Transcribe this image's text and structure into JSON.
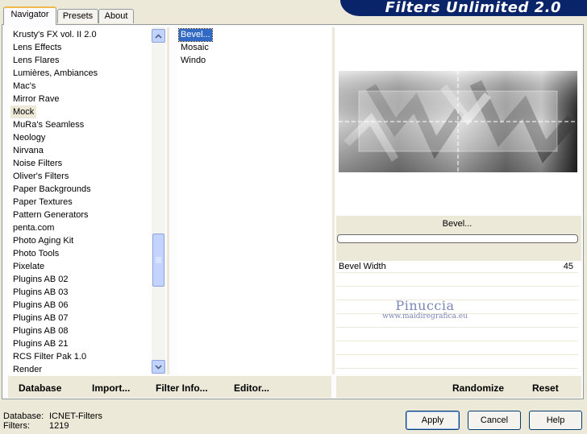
{
  "tabs": [
    {
      "label": "Navigator",
      "active": true
    },
    {
      "label": "Presets",
      "active": false
    },
    {
      "label": "About",
      "active": false
    }
  ],
  "app_title": "Filters Unlimited 2.0",
  "categories": [
    "Krusty's FX vol. II 2.0",
    "Lens Effects",
    "Lens Flares",
    "Lumières, Ambiances",
    "Mac's",
    "Mirror Rave",
    "Mock",
    "MuRa's Seamless",
    "Neology",
    "Nirvana",
    "Noise Filters",
    "Oliver's Filters",
    "Paper Backgrounds",
    "Paper Textures",
    "Pattern Generators",
    "penta.com",
    "Photo Aging Kit",
    "Photo Tools",
    "Pixelate",
    "Plugins AB 02",
    "Plugins AB 03",
    "Plugins AB 06",
    "Plugins AB 07",
    "Plugins AB 08",
    "Plugins AB 21",
    "RCS Filter Pak 1.0",
    "Render"
  ],
  "selected_category": "Mock",
  "filters": [
    "Bevel...",
    "Mosaic",
    "Windo"
  ],
  "selected_filter": "Bevel...",
  "filter_name": "Bevel...",
  "params": [
    {
      "label": "Bevel Width",
      "value": "45"
    }
  ],
  "watermark": {
    "title": "Pinuccia",
    "url": "www.maidiregrafica.eu"
  },
  "left_links": {
    "database": "Database",
    "import": "Import...",
    "filter_info": "Filter Info...",
    "editor": "Editor..."
  },
  "right_links": {
    "randomize": "Randomize",
    "reset": "Reset"
  },
  "status": {
    "database_label": "Database:",
    "database_value": "ICNET-Filters",
    "filters_label": "Filters:",
    "filters_value": "1219"
  },
  "buttons": {
    "apply": "Apply",
    "cancel": "Cancel",
    "help": "Help"
  },
  "colors": {
    "accent": "#0a246a",
    "selection": "#316ac5",
    "tab_highlight": "#f1b74a"
  }
}
